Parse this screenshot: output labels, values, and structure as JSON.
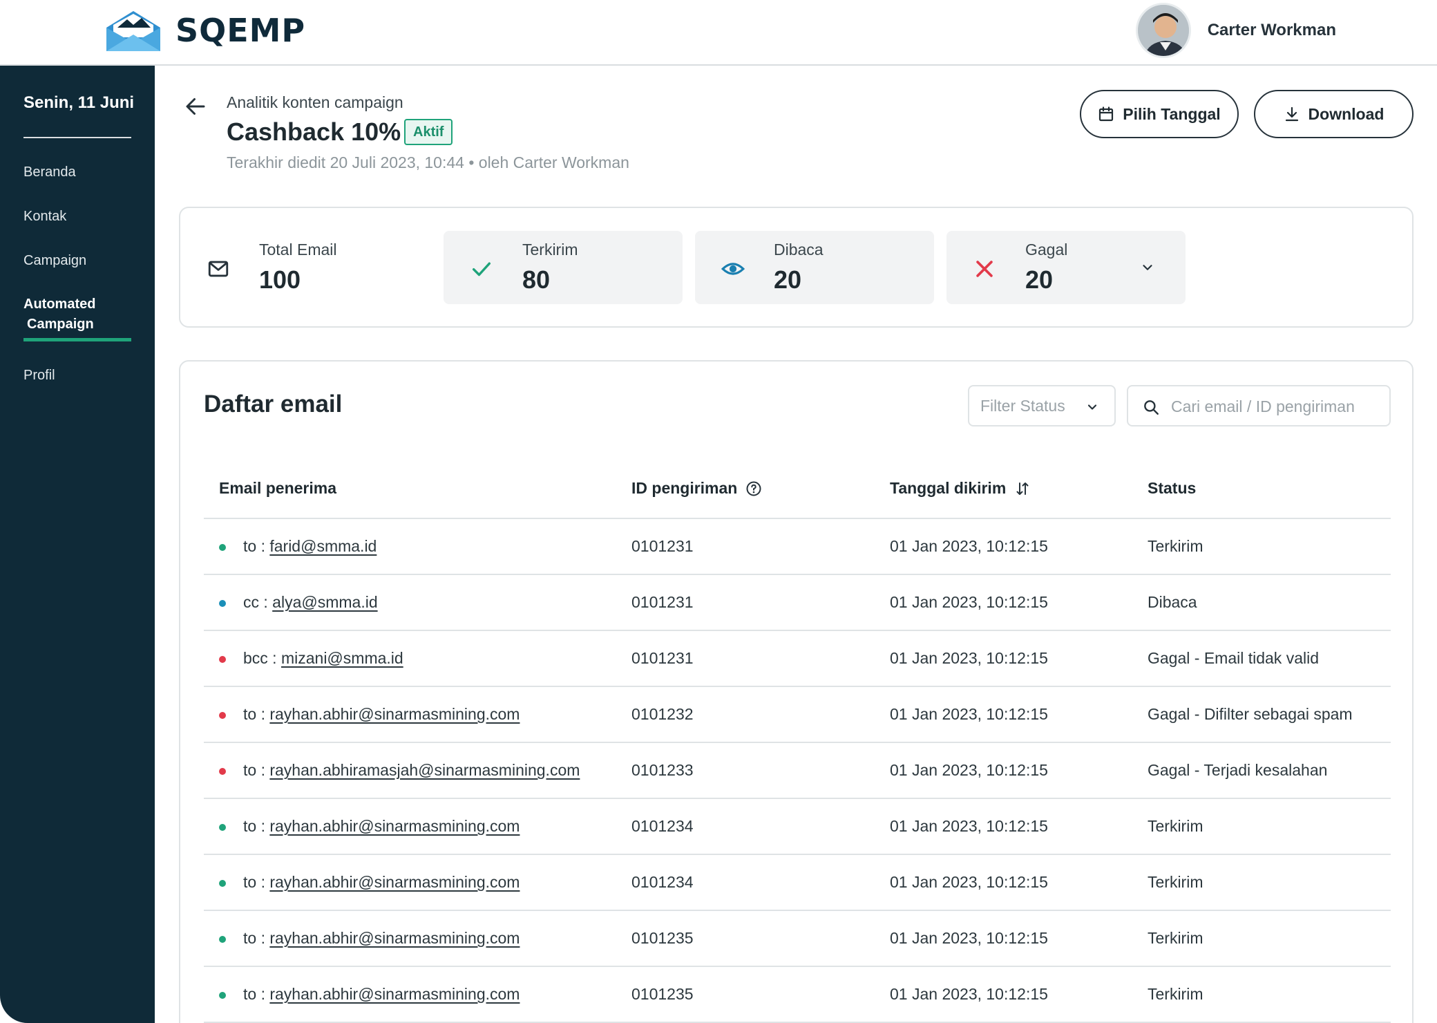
{
  "app": {
    "brand": "SQEMP",
    "user_name": "Carter Workman"
  },
  "sidebar": {
    "date": "Senin, 11 Juni",
    "items": [
      {
        "label": "Beranda"
      },
      {
        "label": "Kontak"
      },
      {
        "label": "Campaign"
      },
      {
        "label_line1": "Automated",
        "label_line2": "Campaign",
        "active": true
      },
      {
        "label": "Profil"
      }
    ]
  },
  "header": {
    "breadcrumb": "Analitik konten campaign",
    "title": "Cashback 10%",
    "badge": "Aktif",
    "subtitle": "Terakhir diedit 20 Juli 2023, 10:44 • oleh Carter Workman",
    "date_button": "Pilih Tanggal",
    "download_button": "Download"
  },
  "stats": [
    {
      "label": "Total Email",
      "value": "100",
      "icon": "mail-icon"
    },
    {
      "label": "Terkirim",
      "value": "80",
      "icon": "check-icon",
      "color": "#1fa37a"
    },
    {
      "label": "Dibaca",
      "value": "20",
      "icon": "eye-icon",
      "color": "#1a7fb0"
    },
    {
      "label": "Gagal",
      "value": "20",
      "icon": "close-icon",
      "color": "#e23a4a"
    }
  ],
  "list": {
    "title": "Daftar email",
    "filter_label": "Filter Status",
    "search_placeholder": "Cari email / ID pengiriman",
    "columns": {
      "email": "Email penerima",
      "id": "ID pengiriman",
      "date": "Tanggal dikirim",
      "status": "Status"
    },
    "rows": [
      {
        "prefix": "to :",
        "email": "farid@smma.id",
        "id": "0101231",
        "date": "01 Jan 2023, 10:12:15",
        "status": "Terkirim",
        "dot": "#1fa37a"
      },
      {
        "prefix": "cc :",
        "email": "alya@smma.id",
        "id": "0101231",
        "date": "01 Jan 2023, 10:12:15",
        "status": "Dibaca",
        "dot": "#1a8fb8"
      },
      {
        "prefix": "bcc :",
        "email": "mizani@smma.id",
        "id": "0101231",
        "date": "01 Jan 2023, 10:12:15",
        "status": "Gagal - Email tidak valid",
        "dot": "#e23a4a"
      },
      {
        "prefix": "to :",
        "email": "rayhan.abhir@sinarmasmining.com",
        "id": "0101232",
        "date": "01 Jan 2023, 10:12:15",
        "status": "Gagal - Difilter sebagai spam",
        "dot": "#e23a4a"
      },
      {
        "prefix": "to :",
        "email": "rayhan.abhiramasjah@sinarmasmining.com",
        "id": "0101233",
        "date": "01 Jan 2023, 10:12:15",
        "status": "Gagal - Terjadi kesalahan",
        "dot": "#e23a4a"
      },
      {
        "prefix": "to :",
        "email": "rayhan.abhir@sinarmasmining.com",
        "id": "0101234",
        "date": "01 Jan 2023, 10:12:15",
        "status": "Terkirim",
        "dot": "#1fa37a"
      },
      {
        "prefix": "to :",
        "email": "rayhan.abhir@sinarmasmining.com",
        "id": "0101234",
        "date": "01 Jan 2023, 10:12:15",
        "status": "Terkirim",
        "dot": "#1fa37a"
      },
      {
        "prefix": "to :",
        "email": "rayhan.abhir@sinarmasmining.com",
        "id": "0101235",
        "date": "01 Jan 2023, 10:12:15",
        "status": "Terkirim",
        "dot": "#1fa37a"
      },
      {
        "prefix": "to :",
        "email": "rayhan.abhir@sinarmasmining.com",
        "id": "0101235",
        "date": "01 Jan 2023, 10:12:15",
        "status": "Terkirim",
        "dot": "#1fa37a"
      }
    ]
  }
}
